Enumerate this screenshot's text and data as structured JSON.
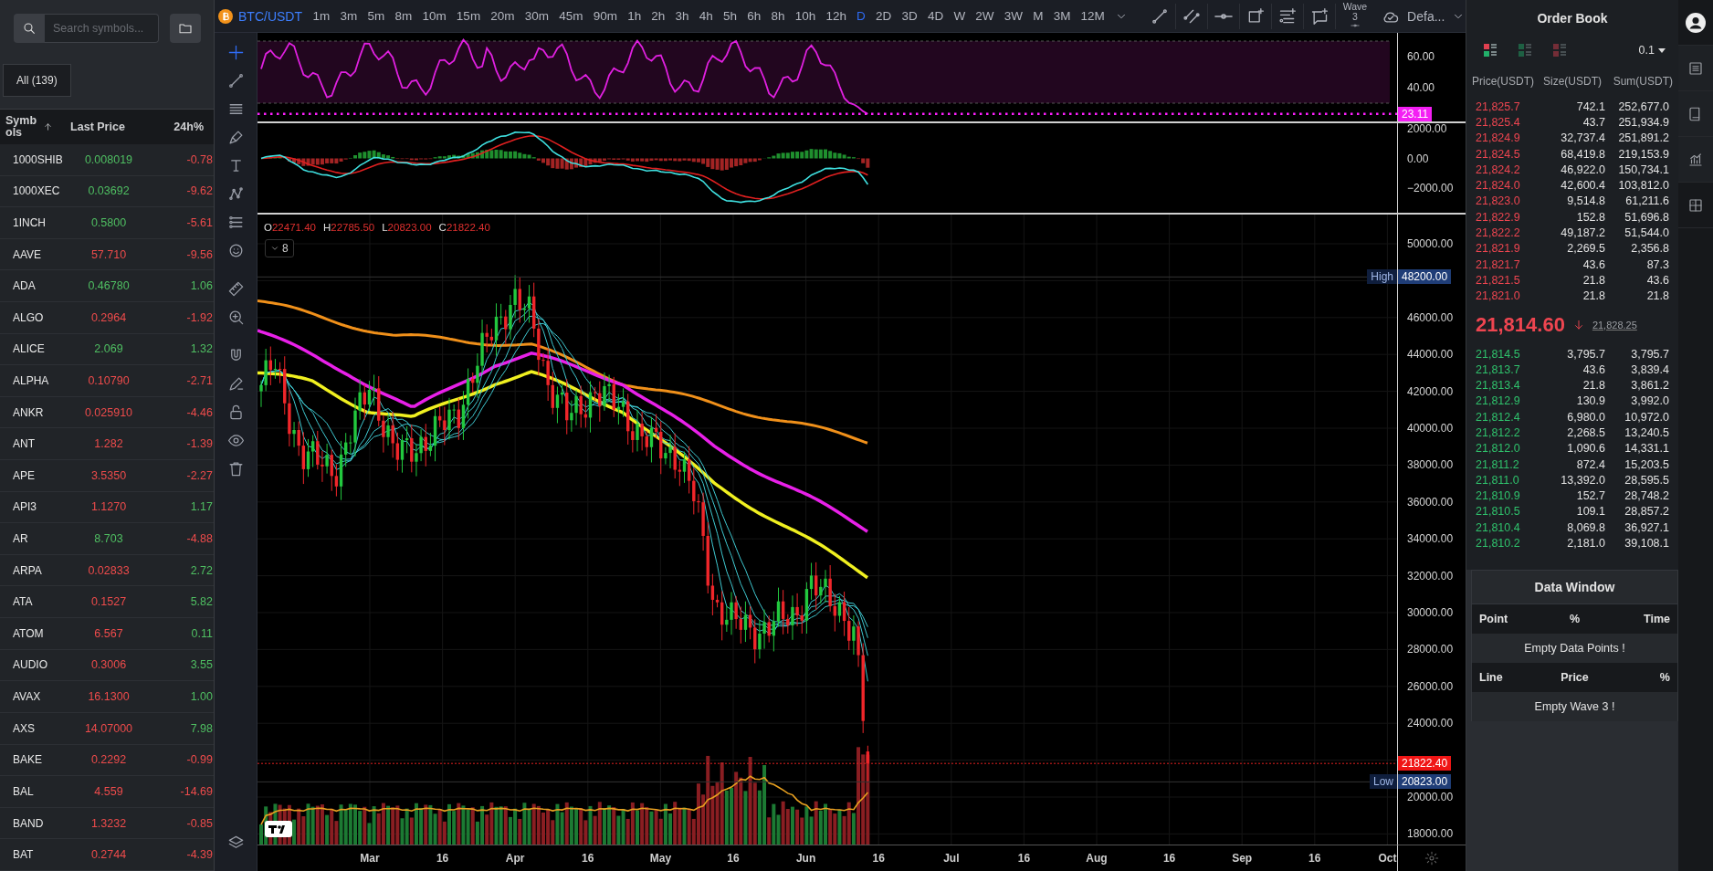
{
  "symbol_panel": {
    "search": {
      "placeholder": "Search symbols..."
    },
    "filter_tabs": [
      {
        "label": "All (139)",
        "selected": true
      }
    ],
    "columns": [
      "Symbols",
      "Last Price",
      "24h%"
    ],
    "rows": [
      {
        "symbol": "1000SHIB",
        "price": "0.008019",
        "price_up": true,
        "change": "-0.78",
        "change_up": false
      },
      {
        "symbol": "1000XEC",
        "price": "0.03692",
        "price_up": true,
        "change": "-9.62",
        "change_up": false
      },
      {
        "symbol": "1INCH",
        "price": "0.5800",
        "price_up": true,
        "change": "-5.61",
        "change_up": false
      },
      {
        "symbol": "AAVE",
        "price": "57.710",
        "price_up": false,
        "change": "-9.56",
        "change_up": false
      },
      {
        "symbol": "ADA",
        "price": "0.46780",
        "price_up": true,
        "change": "1.06",
        "change_up": true
      },
      {
        "symbol": "ALGO",
        "price": "0.2964",
        "price_up": false,
        "change": "-1.92",
        "change_up": false
      },
      {
        "symbol": "ALICE",
        "price": "2.069",
        "price_up": true,
        "change": "1.32",
        "change_up": true
      },
      {
        "symbol": "ALPHA",
        "price": "0.10790",
        "price_up": false,
        "change": "-2.71",
        "change_up": false
      },
      {
        "symbol": "ANKR",
        "price": "0.025910",
        "price_up": false,
        "change": "-4.46",
        "change_up": false
      },
      {
        "symbol": "ANT",
        "price": "1.282",
        "price_up": false,
        "change": "-1.39",
        "change_up": false
      },
      {
        "symbol": "APE",
        "price": "3.5350",
        "price_up": false,
        "change": "-2.27",
        "change_up": false
      },
      {
        "symbol": "API3",
        "price": "1.1270",
        "price_up": false,
        "change": "1.17",
        "change_up": true
      },
      {
        "symbol": "AR",
        "price": "8.703",
        "price_up": true,
        "change": "-4.88",
        "change_up": false
      },
      {
        "symbol": "ARPA",
        "price": "0.02833",
        "price_up": false,
        "change": "2.72",
        "change_up": true
      },
      {
        "symbol": "ATA",
        "price": "0.1527",
        "price_up": false,
        "change": "5.82",
        "change_up": true
      },
      {
        "symbol": "ATOM",
        "price": "6.567",
        "price_up": false,
        "change": "0.11",
        "change_up": true
      },
      {
        "symbol": "AUDIO",
        "price": "0.3006",
        "price_up": false,
        "change": "3.55",
        "change_up": true
      },
      {
        "symbol": "AVAX",
        "price": "16.1300",
        "price_up": false,
        "change": "1.00",
        "change_up": true
      },
      {
        "symbol": "AXS",
        "price": "14.07000",
        "price_up": false,
        "change": "7.98",
        "change_up": true
      },
      {
        "symbol": "BAKE",
        "price": "0.2292",
        "price_up": false,
        "change": "-0.99",
        "change_up": false
      },
      {
        "symbol": "BAL",
        "price": "4.559",
        "price_up": false,
        "change": "-14.69",
        "change_up": false
      },
      {
        "symbol": "BAND",
        "price": "1.3232",
        "price_up": false,
        "change": "-0.85",
        "change_up": false
      },
      {
        "symbol": "BAT",
        "price": "0.2744",
        "price_up": false,
        "change": "-4.39",
        "change_up": false
      }
    ]
  },
  "toolbar": {
    "symbol": "BTC/USDT",
    "intervals": [
      {
        "label": "1m",
        "selected": false
      },
      {
        "label": "3m",
        "selected": false
      },
      {
        "label": "5m",
        "selected": false
      },
      {
        "label": "8m",
        "selected": false
      },
      {
        "label": "10m",
        "selected": false
      },
      {
        "label": "15m",
        "selected": false
      },
      {
        "label": "20m",
        "selected": false
      },
      {
        "label": "30m",
        "selected": false
      },
      {
        "label": "45m",
        "selected": false
      },
      {
        "label": "90m",
        "selected": false
      },
      {
        "label": "1h",
        "selected": false
      },
      {
        "label": "2h",
        "selected": false
      },
      {
        "label": "3h",
        "selected": false
      },
      {
        "label": "4h",
        "selected": false
      },
      {
        "label": "5h",
        "selected": false
      },
      {
        "label": "6h",
        "selected": false
      },
      {
        "label": "8h",
        "selected": false
      },
      {
        "label": "10h",
        "selected": false
      },
      {
        "label": "12h",
        "selected": false
      },
      {
        "label": "D",
        "selected": true
      },
      {
        "label": "2D",
        "selected": false
      },
      {
        "label": "3D",
        "selected": false
      },
      {
        "label": "4D",
        "selected": false
      },
      {
        "label": "W",
        "selected": false
      },
      {
        "label": "2W",
        "selected": false
      },
      {
        "label": "3W",
        "selected": false
      },
      {
        "label": "M",
        "selected": false
      },
      {
        "label": "3M",
        "selected": false
      },
      {
        "label": "12M",
        "selected": false
      }
    ],
    "wave": "Wave 3",
    "layout": "Defa..."
  },
  "drawing_tools": [
    {
      "kind": "crosshair",
      "selected": true
    },
    {
      "kind": "trend-line",
      "selected": false
    },
    {
      "kind": "lines",
      "selected": false
    },
    {
      "kind": "brush",
      "selected": false
    },
    {
      "kind": "text",
      "selected": false
    },
    {
      "kind": "pattern",
      "selected": false
    },
    {
      "kind": "fib",
      "selected": false
    },
    {
      "kind": "emoji",
      "selected": false
    },
    {
      "kind": "ruler",
      "selected": false
    },
    {
      "kind": "zoom",
      "selected": false
    },
    {
      "kind": "magnet",
      "selected": false
    },
    {
      "kind": "pencil",
      "selected": false
    },
    {
      "kind": "lock",
      "selected": false
    },
    {
      "kind": "eye",
      "selected": false
    },
    {
      "kind": "trash",
      "selected": false
    },
    {
      "kind": "layers",
      "selected": false
    }
  ],
  "chart": {
    "legend": [
      {
        "key": "O",
        "value": "22471.40"
      },
      {
        "key": "H",
        "value": "22785.50"
      },
      {
        "key": "L",
        "value": "20823.00"
      },
      {
        "key": "C",
        "value": "21822.40"
      }
    ],
    "indicators_toggle": "8",
    "rsi_axis": [
      "60.00",
      "40.00"
    ],
    "rsi_badge": "23.11",
    "macd_axis": [
      "2000.00",
      "0.00",
      "−2000.00"
    ],
    "price_axis": [
      "50000.00",
      "46000.00",
      "44000.00",
      "42000.00",
      "40000.00",
      "38000.00",
      "36000.00",
      "34000.00",
      "32000.00",
      "30000.00",
      "28000.00",
      "26000.00",
      "24000.00",
      "20000.00",
      "18000.00"
    ],
    "high": {
      "label": "High",
      "value": "48200.00"
    },
    "low": {
      "label": "Low",
      "value": "20823.00"
    },
    "last_price": "21822.40",
    "time_axis": [
      "Mar",
      "16",
      "Apr",
      "16",
      "May",
      "16",
      "Jun",
      "16",
      "Jul",
      "16",
      "Aug",
      "16",
      "Sep",
      "16",
      "Oct"
    ]
  },
  "order_book": {
    "title": "Order Book",
    "view_modes": [
      {
        "kind": "both",
        "selected": true
      },
      {
        "kind": "bids",
        "selected": false
      },
      {
        "kind": "asks",
        "selected": false
      }
    ],
    "precision": "0.1",
    "columns": [
      "Price(USDT)",
      "Size(USDT)",
      "Sum(USDT)"
    ],
    "asks": [
      {
        "price": "21,825.7",
        "size": "742.1",
        "sum": "252,677.0"
      },
      {
        "price": "21,825.4",
        "size": "43.7",
        "sum": "251,934.9"
      },
      {
        "price": "21,824.9",
        "size": "32,737.4",
        "sum": "251,891.2"
      },
      {
        "price": "21,824.5",
        "size": "68,419.8",
        "sum": "219,153.9"
      },
      {
        "price": "21,824.2",
        "size": "46,922.0",
        "sum": "150,734.1"
      },
      {
        "price": "21,824.0",
        "size": "42,600.4",
        "sum": "103,812.0"
      },
      {
        "price": "21,823.0",
        "size": "9,514.8",
        "sum": "61,211.6"
      },
      {
        "price": "21,822.9",
        "size": "152.8",
        "sum": "51,696.8"
      },
      {
        "price": "21,822.2",
        "size": "49,187.2",
        "sum": "51,544.0"
      },
      {
        "price": "21,821.9",
        "size": "2,269.5",
        "sum": "2,356.8"
      },
      {
        "price": "21,821.7",
        "size": "43.6",
        "sum": "87.3"
      },
      {
        "price": "21,821.5",
        "size": "21.8",
        "sum": "43.6"
      },
      {
        "price": "21,821.0",
        "size": "21.8",
        "sum": "21.8"
      }
    ],
    "last_price": "21,814.60",
    "price_falling": true,
    "mark_price": "21,828.25",
    "bids": [
      {
        "price": "21,814.5",
        "size": "3,795.7",
        "sum": "3,795.7"
      },
      {
        "price": "21,813.7",
        "size": "43.6",
        "sum": "3,839.4"
      },
      {
        "price": "21,813.4",
        "size": "21.8",
        "sum": "3,861.2"
      },
      {
        "price": "21,812.9",
        "size": "130.9",
        "sum": "3,992.0"
      },
      {
        "price": "21,812.4",
        "size": "6,980.0",
        "sum": "10,972.0"
      },
      {
        "price": "21,812.2",
        "size": "2,268.5",
        "sum": "13,240.5"
      },
      {
        "price": "21,812.0",
        "size": "1,090.6",
        "sum": "14,331.1"
      },
      {
        "price": "21,811.2",
        "size": "872.4",
        "sum": "15,203.5"
      },
      {
        "price": "21,811.0",
        "size": "13,392.0",
        "sum": "28,595.5"
      },
      {
        "price": "21,810.9",
        "size": "152.7",
        "sum": "28,748.2"
      },
      {
        "price": "21,810.5",
        "size": "109.1",
        "sum": "28,857.2"
      },
      {
        "price": "21,810.4",
        "size": "8,069.8",
        "sum": "36,927.1"
      },
      {
        "price": "21,810.2",
        "size": "2,181.0",
        "sum": "39,108.1"
      }
    ]
  },
  "data_window": {
    "title": "Data Window",
    "points_columns": [
      "Point",
      "%",
      "Time"
    ],
    "points_empty": "Empty Data Points !",
    "lines_columns": [
      "Line",
      "Price",
      "%"
    ],
    "lines_empty": "Empty Wave 3 !"
  }
}
